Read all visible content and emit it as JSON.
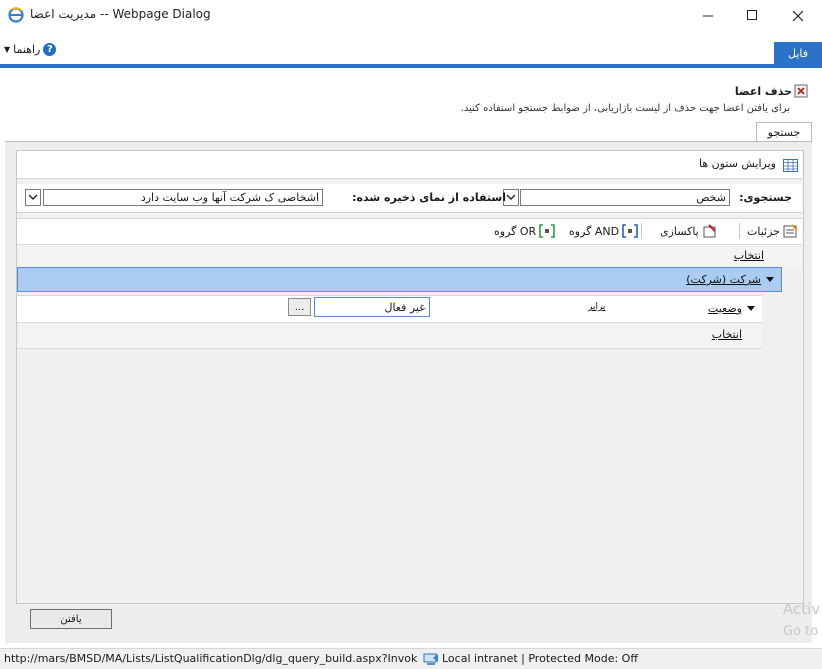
{
  "window": {
    "title": "مدیریت اعضا -- Webpage Dialog"
  },
  "menu": {
    "help_label": "راهنما",
    "file_tab": "فایل"
  },
  "page": {
    "title": "حذف اعضا",
    "description": "برای یافتن اعضا جهت حذف از لیست بازاریابی، از ضوابط جستجو استفاده کنید."
  },
  "tabs": {
    "search": "جستجو"
  },
  "columns": {
    "edit_label": "ویرایش ستون ها"
  },
  "search": {
    "lookfor_label": "جستجوی:",
    "lookfor_value": "شخص",
    "savedview_label": "استفاده از نمای ذخیره شده:",
    "savedview_value": "اشخاصی ک شرکت آنها وب سایت دارد"
  },
  "toolbar": {
    "details": "جزئیات",
    "clear": "پاکسازی",
    "group_and": "گروه AND",
    "group_or": "گروه OR"
  },
  "query": {
    "select_header": "انتخاب",
    "group_label": "شرکت (شرکت)",
    "condition": {
      "field": "وضعیت",
      "operator": "برابر",
      "value": "غیر فعال",
      "lookup_button": "..."
    },
    "select_row": "انتخاب"
  },
  "buttons": {
    "find": "یافتن"
  },
  "status": {
    "url": "http://mars/BMSD/MA/Lists/ListQualificationDlg/dlg_query_build.aspx?Invoke",
    "zone": "Local intranet | Protected Mode: Off"
  },
  "watermark": {
    "line1": "Activ",
    "line2": "Go to"
  },
  "colors": {
    "accent": "#2a73c8",
    "group_highlight": "#a9ccf0"
  }
}
